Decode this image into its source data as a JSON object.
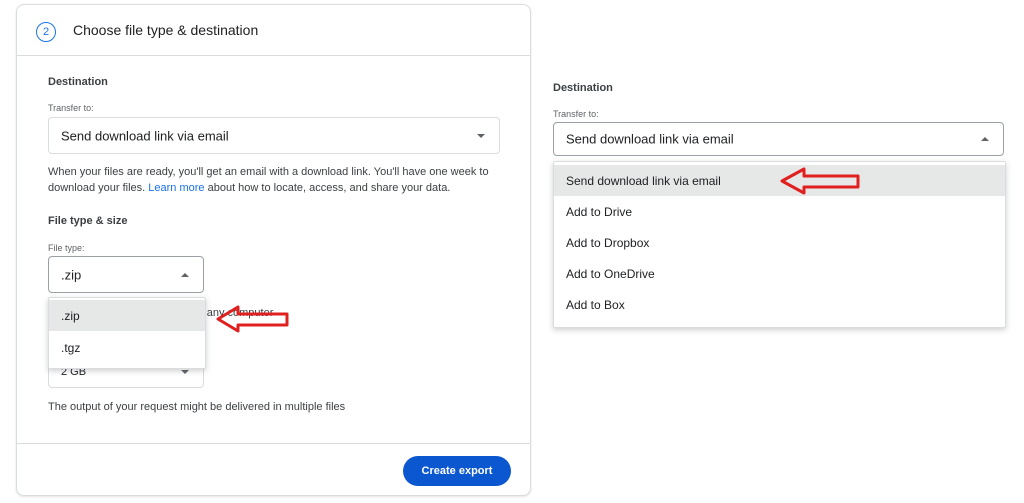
{
  "left_panel": {
    "step_number": "2",
    "step_title": "Choose file type & destination",
    "destination_title": "Destination",
    "transfer_label": "Transfer to:",
    "transfer_value": "Send download link via email",
    "help_line1": "When your files are ready, you'll get an email with a download link. You'll have one week to",
    "help_line2_before": "download your files. ",
    "help_link": "Learn more",
    "help_line2_after": " about how to locate, access, and share your data.",
    "file_type_title": "File type & size",
    "file_type_label": "File type:",
    "file_type_value": ".zip",
    "file_type_options": [
      ".zip",
      ".tgz"
    ],
    "hidden_text_fragment": "ost any computer",
    "size_value": "2 GB",
    "output_note": "The output of your request might be delivered in multiple files",
    "create_button": "Create export"
  },
  "right_panel": {
    "destination_title": "Destination",
    "transfer_label": "Transfer to:",
    "transfer_value": "Send download link via email",
    "options": [
      "Send download link via email",
      "Add to Drive",
      "Add to Dropbox",
      "Add to OneDrive",
      "Add to Box"
    ]
  },
  "colors": {
    "accent": "#1a73e8",
    "button": "#0b57d0",
    "annotation_arrow": "#e0201f",
    "selected_row": "#e6e7e7"
  }
}
